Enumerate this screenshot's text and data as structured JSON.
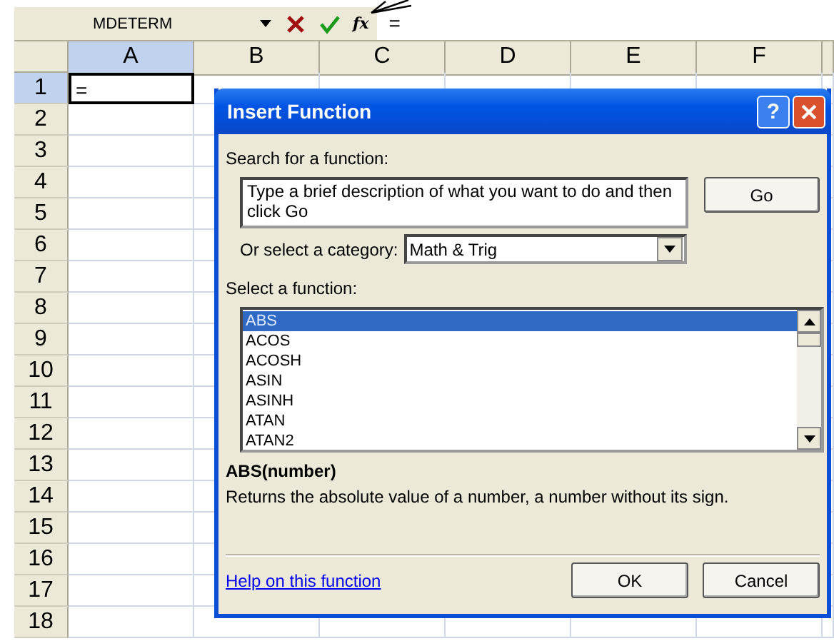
{
  "formula_bar": {
    "name_box": "MDETERM",
    "function_button": "fx",
    "formula": "="
  },
  "sheet": {
    "columns": [
      {
        "label": "A",
        "selected": true
      },
      {
        "label": "B",
        "selected": false
      },
      {
        "label": "C",
        "selected": false
      },
      {
        "label": "D",
        "selected": false
      },
      {
        "label": "E",
        "selected": false
      },
      {
        "label": "F",
        "selected": false
      }
    ],
    "rows": [
      {
        "label": "1",
        "selected": true,
        "cells": [
          "="
        ]
      },
      {
        "label": "2",
        "selected": false
      },
      {
        "label": "3",
        "selected": false
      },
      {
        "label": "4",
        "selected": false
      },
      {
        "label": "5",
        "selected": false
      },
      {
        "label": "6",
        "selected": false
      },
      {
        "label": "7",
        "selected": false
      },
      {
        "label": "8",
        "selected": false
      },
      {
        "label": "9",
        "selected": false
      },
      {
        "label": "10",
        "selected": false
      },
      {
        "label": "11",
        "selected": false
      },
      {
        "label": "12",
        "selected": false
      },
      {
        "label": "13",
        "selected": false
      },
      {
        "label": "14",
        "selected": false
      },
      {
        "label": "15",
        "selected": false
      },
      {
        "label": "16",
        "selected": false
      },
      {
        "label": "17",
        "selected": false
      },
      {
        "label": "18",
        "selected": false
      }
    ]
  },
  "dialog": {
    "title": "Insert Function",
    "help_button": "?",
    "search_label": "Search for a function:",
    "search_value": "Type a brief description of what you want to do and then click Go",
    "go_button": "Go",
    "category_label": "Or select a category:",
    "category_value": "Math & Trig",
    "list_label": "Select a function:",
    "functions": [
      {
        "name": "ABS",
        "selected": true
      },
      {
        "name": "ACOS",
        "selected": false
      },
      {
        "name": "ACOSH",
        "selected": false
      },
      {
        "name": "ASIN",
        "selected": false
      },
      {
        "name": "ASINH",
        "selected": false
      },
      {
        "name": "ATAN",
        "selected": false
      },
      {
        "name": "ATAN2",
        "selected": false
      }
    ],
    "signature": "ABS(number)",
    "description": "Returns the absolute value of a number, a number without its sign.",
    "help_link": "Help on this function",
    "buttons": [
      "OK",
      "Cancel"
    ]
  }
}
